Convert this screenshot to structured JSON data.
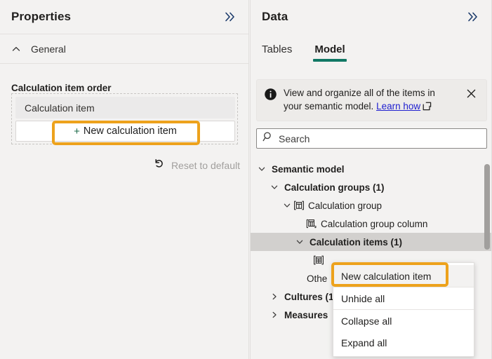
{
  "left_panel": {
    "title": "Properties",
    "collapse_icon": "chevron-double-right-icon",
    "section": {
      "label": "General",
      "caret": "chevron-up-icon"
    },
    "field_label": "Calculation item order",
    "chip_label": "Calculation item",
    "new_item_button": {
      "plus": "+",
      "label": "New calculation item"
    },
    "reset": {
      "icon": "undo-arrow-icon",
      "label": "Reset to default"
    }
  },
  "right_panel": {
    "title": "Data",
    "collapse_icon": "chevron-double-right-icon",
    "tabs": [
      {
        "label": "Tables",
        "active": false
      },
      {
        "label": "Model",
        "active": true
      }
    ],
    "info_banner": {
      "icon": "info-circle-icon",
      "text_line1": "View and organize all of the items in",
      "text_line2": "your semantic model.",
      "link_label": "Learn how",
      "external_icon": "open-in-new-icon",
      "close_icon": "close-icon"
    },
    "search": {
      "icon": "search-icon",
      "placeholder": "Search"
    },
    "tree": [
      {
        "label": "Semantic model",
        "level": 0,
        "twisty": "chevron-down-icon",
        "icon": null,
        "bold": true,
        "selected": false
      },
      {
        "label": "Calculation groups (1)",
        "level": 1,
        "twisty": "chevron-down-icon",
        "icon": null,
        "bold": true,
        "selected": false
      },
      {
        "label": "Calculation group",
        "level": 2,
        "twisty": "chevron-down-icon",
        "icon": "calculation-group-icon",
        "bold": false,
        "selected": false
      },
      {
        "label": "Calculation group column",
        "level": 3,
        "twisty": null,
        "icon": "calculation-group-column-icon",
        "bold": false,
        "selected": false
      },
      {
        "label": "Calculation items (1)",
        "level": 3,
        "twisty": "chevron-down-icon",
        "icon": null,
        "bold": true,
        "selected": true
      },
      {
        "label": "",
        "level": 4,
        "twisty": null,
        "icon": "calculation-item-icon",
        "bold": false,
        "selected": false
      },
      {
        "label": "Othe",
        "level": 3,
        "twisty": null,
        "icon": null,
        "bold": false,
        "selected": false
      },
      {
        "label": "Cultures (1",
        "level": 1,
        "twisty": "chevron-right-icon",
        "icon": null,
        "bold": true,
        "selected": false
      },
      {
        "label": "Measures",
        "level": 1,
        "twisty": "chevron-right-icon",
        "icon": null,
        "bold": true,
        "selected": false
      }
    ],
    "scrollbar": "vertical-scrollbar"
  },
  "context_menu": {
    "items": [
      {
        "label": "New calculation item",
        "highlighted": true
      },
      {
        "label": "Unhide all",
        "highlighted": false
      },
      {
        "label": "Collapse all",
        "highlighted": false
      },
      {
        "label": "Expand all",
        "highlighted": false
      }
    ]
  },
  "colors": {
    "highlight_ring": "#eda21c",
    "tab_accent": "#117865",
    "panel_bg": "#f3f2f1",
    "selection": "#d2d0ce",
    "link": "#2020d0"
  }
}
